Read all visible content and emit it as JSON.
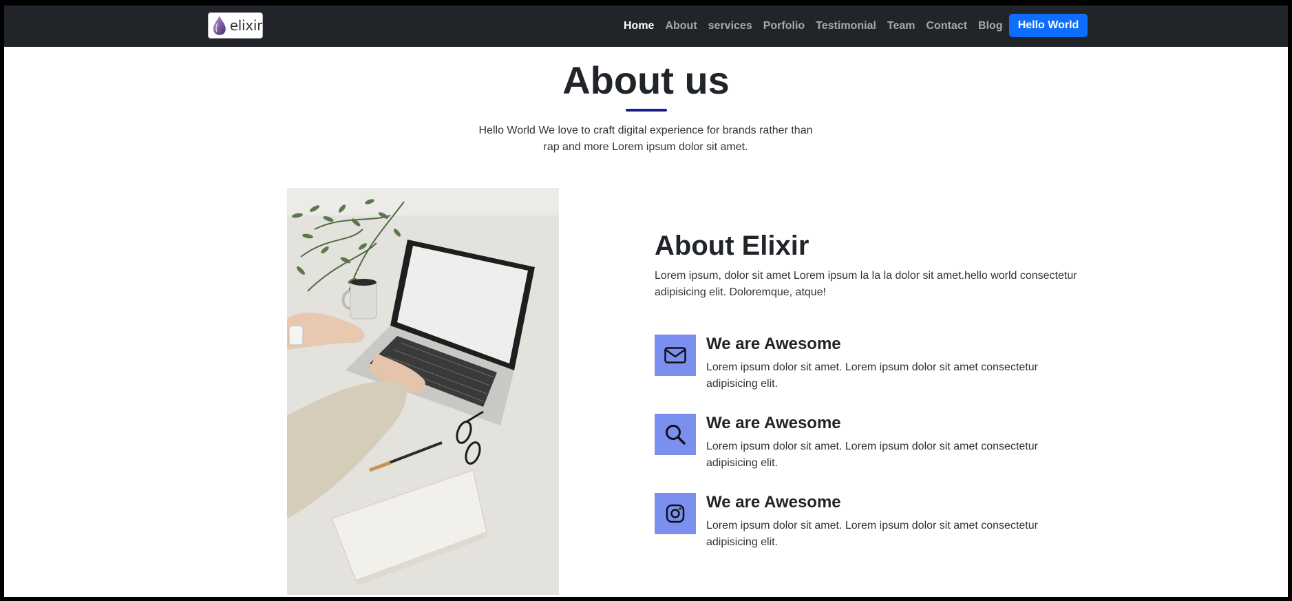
{
  "brand": {
    "name": "elixir"
  },
  "nav": {
    "links": [
      "Home",
      "About",
      "services",
      "Porfolio",
      "Testimonial",
      "Team",
      "Contact",
      "Blog"
    ],
    "button_label": "Hello World"
  },
  "header": {
    "title": "About us",
    "subtitle": "Hello World We love to craft digital experience for brands rather than rap and more Lorem ipsum dolor sit amet."
  },
  "about": {
    "title": "About Elixir",
    "text": "Lorem ipsum, dolor sit amet Lorem ipsum la la la dolor sit amet.hello world consectetur adipisicing elit. Doloremque, atque!",
    "features": [
      {
        "icon": "envelope-icon",
        "title": "We are Awesome",
        "text": "Lorem ipsum dolor sit amet. Lorem ipsum dolor sit amet consectetur adipisicing elit."
      },
      {
        "icon": "search-icon",
        "title": "We are Awesome",
        "text": "Lorem ipsum dolor sit amet. Lorem ipsum dolor sit amet consectetur adipisicing elit."
      },
      {
        "icon": "instagram-icon",
        "title": "We are Awesome",
        "text": "Lorem ipsum dolor sit amet. Lorem ipsum dolor sit amet consectetur adipisicing elit."
      }
    ]
  },
  "colors": {
    "navbar_bg": "#212529",
    "button_bg": "#0d6efd",
    "icon_box_bg": "#7b8ff0",
    "underline": "#1a1a8c"
  }
}
